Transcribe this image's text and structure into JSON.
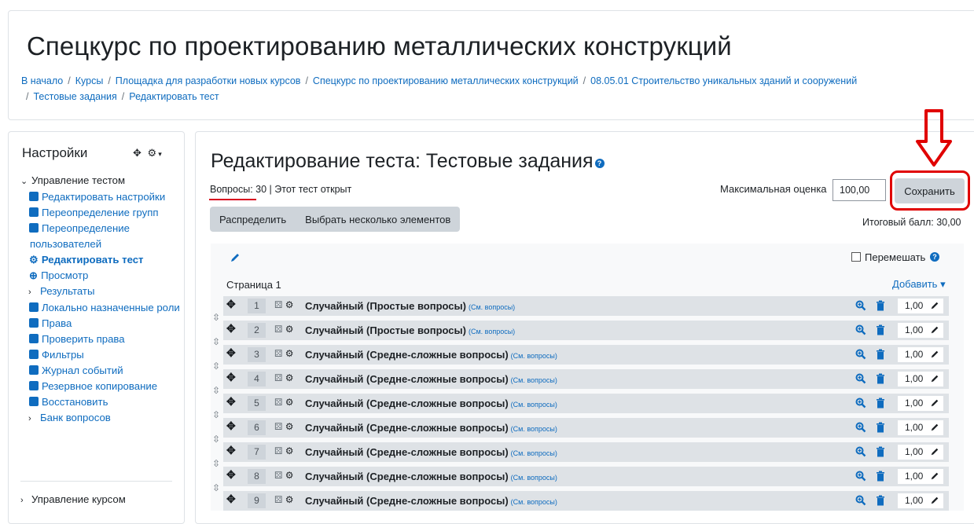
{
  "header": {
    "title": "Спецкурс по проектированию металлических конструкций",
    "breadcrumb": [
      "В начало",
      "Курсы",
      "Площадка для разработки новых курсов",
      "Спецкурс по проектированию металлических конструкций",
      "08.05.01 Строительство уникальных зданий и сооружений",
      "Тестовые задания",
      "Редактировать тест"
    ]
  },
  "sidebar": {
    "title": "Настройки",
    "section": "Управление тестом",
    "items": [
      {
        "label": "Редактировать настройки",
        "icon": "square-icon"
      },
      {
        "label": "Переопределение групп",
        "icon": "square-icon"
      },
      {
        "label": "Переопределение пользователей",
        "icon": "square-icon"
      },
      {
        "label": "Редактировать тест",
        "icon": "gear-icon",
        "active": true
      },
      {
        "label": "Просмотр",
        "icon": "zoom-icon"
      },
      {
        "label": "Результаты",
        "icon": "chevron-right-icon"
      },
      {
        "label": "Локально назначенные роли",
        "icon": "square-icon"
      },
      {
        "label": "Права",
        "icon": "square-icon"
      },
      {
        "label": "Проверить права",
        "icon": "square-icon"
      },
      {
        "label": "Фильтры",
        "icon": "square-icon"
      },
      {
        "label": "Журнал событий",
        "icon": "square-icon"
      },
      {
        "label": "Резервное копирование",
        "icon": "square-icon"
      },
      {
        "label": "Восстановить",
        "icon": "square-icon"
      },
      {
        "label": "Банк вопросов",
        "icon": "chevron-right-icon"
      }
    ],
    "bottom": "Управление курсом"
  },
  "main": {
    "title": "Редактирование теста: Тестовые задания",
    "questions_link": "Вопросы: 30",
    "separator": "|",
    "status": "Этот тест открыт",
    "max_grade_label": "Максимальная оценка",
    "max_grade_value": "100,00",
    "save_label": "Сохранить",
    "repaginate_label": "Распределить",
    "select_multiple_label": "Выбрать несколько элементов",
    "total_label": "Итоговый балл: 30,00",
    "shuffle_label": "Перемешать",
    "page_label": "Страница 1",
    "add_label": "Добавить ▾",
    "slots": [
      {
        "num": "1",
        "name": "Случайный (Простые вопросы)",
        "see": "(См. вопросы)",
        "mark": "1,00"
      },
      {
        "num": "2",
        "name": "Случайный (Простые вопросы)",
        "see": "(См. вопросы)",
        "mark": "1,00"
      },
      {
        "num": "3",
        "name": "Случайный (Средне-сложные вопросы)",
        "see": "(См. вопросы)",
        "mark": "1,00"
      },
      {
        "num": "4",
        "name": "Случайный (Средне-сложные вопросы)",
        "see": "(См. вопросы)",
        "mark": "1,00"
      },
      {
        "num": "5",
        "name": "Случайный (Средне-сложные вопросы)",
        "see": "(См. вопросы)",
        "mark": "1,00"
      },
      {
        "num": "6",
        "name": "Случайный (Средне-сложные вопросы)",
        "see": "(См. вопросы)",
        "mark": "1,00"
      },
      {
        "num": "7",
        "name": "Случайный (Средне-сложные вопросы)",
        "see": "(См. вопросы)",
        "mark": "1,00"
      },
      {
        "num": "8",
        "name": "Случайный (Средне-сложные вопросы)",
        "see": "(См. вопросы)",
        "mark": "1,00"
      },
      {
        "num": "9",
        "name": "Случайный (Средне-сложные вопросы)",
        "see": "(См. вопросы)",
        "mark": "1,00"
      }
    ]
  },
  "colors": {
    "link": "#0f6cbf",
    "highlight": "#e00000",
    "slot_bg": "#dee2e6"
  }
}
